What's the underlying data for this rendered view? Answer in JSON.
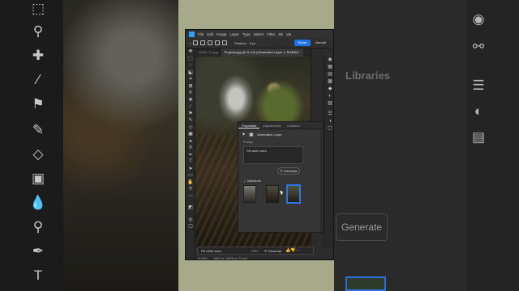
{
  "menu": {
    "items": [
      "File",
      "Edit",
      "Image",
      "Layer",
      "Type",
      "Select",
      "Filter",
      "3D",
      "Vie"
    ]
  },
  "options": {
    "position_label": "Position:",
    "position_value": "8 px",
    "share_label": "Share",
    "blend_label": "Normal"
  },
  "doc_tabs": {
    "tab1": "11311 71..jpg",
    "tab2": "Projects.jpg @ 11.1% (Generative Layer 1, RGB/8) *"
  },
  "properties": {
    "tab_properties": "Properties",
    "tab_adjustments": "Adjustments",
    "tab_libraries": "Libraries",
    "layer_label": "Generative Layer",
    "prompt_label": "Prompt",
    "prompt_value": "Fill white area",
    "generate_label": "Generate",
    "variations_label": "Variations"
  },
  "context_bar": {
    "prompt_text": "Fill white area",
    "page_indicator": "2/3",
    "generate_label": "Generate"
  },
  "status": {
    "zoom": "11.09%",
    "dimensions": "4640 px x 6976 px (72 ppi)"
  },
  "background": {
    "libraries_label": "Libraries",
    "generate_label": "Generate"
  },
  "colors": {
    "accent": "#1f73e8",
    "panel": "#353535",
    "frame": "#a7a98b"
  }
}
